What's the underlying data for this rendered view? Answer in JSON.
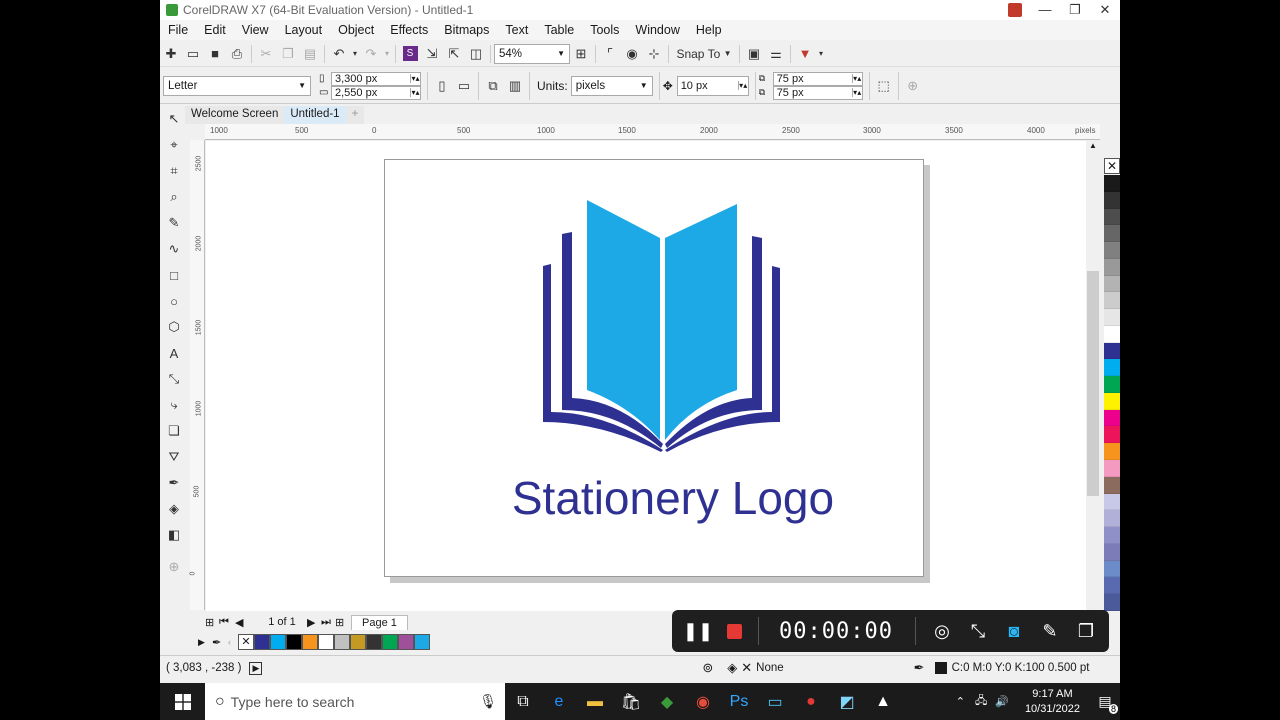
{
  "window": {
    "title": "CorelDRAW X7 (64-Bit Evaluation Version) - Untitled-1",
    "minimize": "—",
    "restore": "❐",
    "close": "✕"
  },
  "menu": [
    "File",
    "Edit",
    "View",
    "Layout",
    "Object",
    "Effects",
    "Bitmaps",
    "Text",
    "Table",
    "Tools",
    "Window",
    "Help"
  ],
  "toolbar": {
    "zoom": "54%",
    "snap_to": "Snap To"
  },
  "property_bar": {
    "paper": "Letter",
    "width": "3,300 px",
    "height": "2,550 px",
    "units_label": "Units:",
    "units": "pixels",
    "nudge": "10 px",
    "dup_x": "75 px",
    "dup_y": "75 px"
  },
  "tabs": [
    "Welcome Screen",
    "Untitled-1"
  ],
  "ruler": {
    "h_ticks": [
      "1000",
      "500",
      "0",
      "500",
      "1000",
      "1500",
      "2000",
      "2500",
      "3000",
      "3500",
      "4000"
    ],
    "h_unit": "pixels",
    "v_ticks": [
      "2500",
      "2000",
      "1500",
      "1000",
      "500",
      "0"
    ]
  },
  "logo": {
    "text": "Stationery Logo",
    "text_color": "#2e3192",
    "page_color": "#1ca9e6",
    "cover_color": "#2e3192"
  },
  "page_nav": {
    "count": "1 of 1",
    "page_tab": "Page 1"
  },
  "status": {
    "coords": "( 3,083 , -238 )",
    "fill": "None",
    "outline": "C:0 M:0 Y:0 K:100  0.500 pt"
  },
  "recorder": {
    "timer": "00:00:00"
  },
  "taskbar": {
    "search_placeholder": "Type here to search",
    "time": "9:17 AM",
    "date": "10/31/2022",
    "notif_count": "8"
  },
  "palette_colors": [
    "#1a1a1a",
    "#333333",
    "#4d4d4d",
    "#666666",
    "#808080",
    "#999999",
    "#b3b3b3",
    "#cccccc",
    "#e6e6e6",
    "#ffffff",
    "#2e3192",
    "#00aeef",
    "#00a651",
    "#fff200",
    "#ec008c",
    "#ed145b",
    "#f7941d",
    "#f49ac1",
    "#8b6b5d",
    "#c8c8e8",
    "#b0b0d8",
    "#9090c8",
    "#7c7cb8",
    "#6b8cc8",
    "#5a6ab0",
    "#4a5a9a"
  ],
  "doc_palette": [
    "#2e3192",
    "#00aeef",
    "#000000",
    "#f7941d",
    "#ffffff",
    "#c0c0c0",
    "#c49a22",
    "#333333",
    "#00a651",
    "#a0509a",
    "#1ca9e6"
  ]
}
